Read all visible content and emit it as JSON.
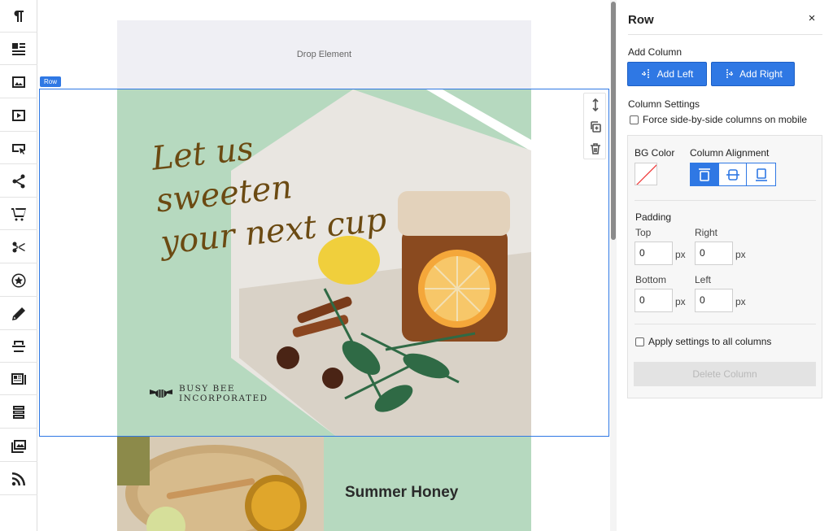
{
  "toolbar": {
    "items": [
      {
        "name": "paragraph-icon"
      },
      {
        "name": "text-block-icon"
      },
      {
        "name": "image-icon"
      },
      {
        "name": "video-icon"
      },
      {
        "name": "button-icon"
      },
      {
        "name": "share-icon"
      },
      {
        "name": "cart-icon"
      },
      {
        "name": "scissors-icon"
      },
      {
        "name": "star-icon"
      },
      {
        "name": "pencil-icon"
      },
      {
        "name": "divider-icon"
      },
      {
        "name": "article-icon"
      },
      {
        "name": "stack-icon"
      },
      {
        "name": "gallery-icon"
      },
      {
        "name": "rss-icon"
      }
    ]
  },
  "canvas": {
    "drop_label": "Drop Element",
    "row_tag": "Row",
    "hero": {
      "headline_line1": "Let us sweeten",
      "headline_line2": "your next cup",
      "brand_line1": "BUSY BEE",
      "brand_line2": "INCORPORATED"
    },
    "lower_title": "Summer Honey"
  },
  "panel": {
    "title": "Row",
    "close": "×",
    "add_column_label": "Add Column",
    "add_left": "Add Left",
    "add_right": "Add Right",
    "column_settings_label": "Column Settings",
    "force_side_label": "Force side-by-side columns on mobile",
    "bg_color_label": "BG Color",
    "column_alignment_label": "Column Alignment",
    "padding_label": "Padding",
    "top_label": "Top",
    "right_label": "Right",
    "bottom_label": "Bottom",
    "left_label": "Left",
    "top_value": "0",
    "right_value": "0",
    "bottom_value": "0",
    "left_value": "0",
    "unit": "px",
    "apply_all_label": "Apply settings to all columns",
    "delete_column": "Delete Column"
  },
  "colors": {
    "accent": "#2f78e4",
    "hero_bg": "#b6d9bf",
    "headline": "#6b4a12"
  }
}
